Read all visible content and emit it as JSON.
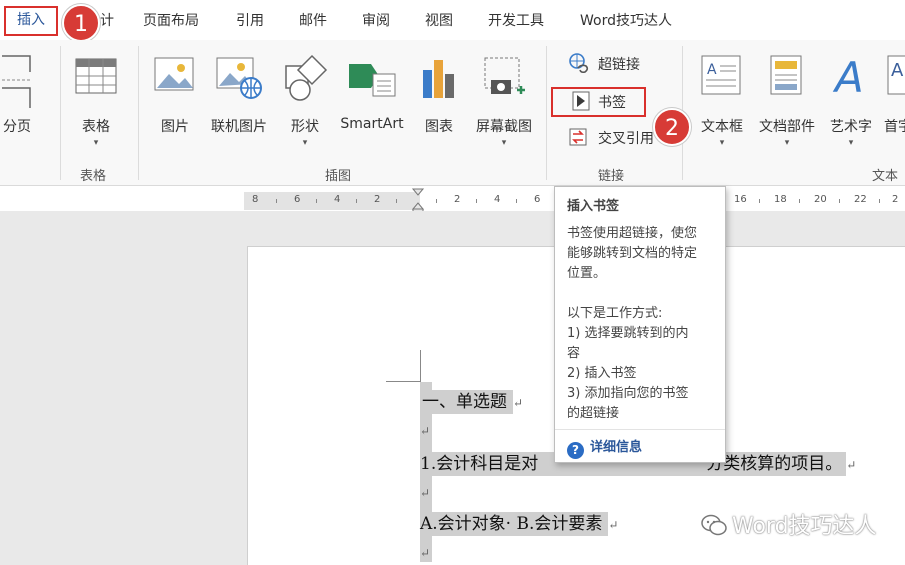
{
  "tabs": {
    "insert": "插入",
    "design_partial": "计",
    "page_layout": "页面布局",
    "references": "引用",
    "mailings": "邮件",
    "review": "审阅",
    "view": "视图",
    "developer": "开发工具",
    "addin": "Word技巧达人"
  },
  "badges": {
    "one": "1",
    "two": "2"
  },
  "ribbon": {
    "page_break": "分页",
    "table": "表格",
    "picture": "图片",
    "online_picture": "联机图片",
    "shapes": "形状",
    "smartart": "SmartArt",
    "chart": "图表",
    "screenshot": "屏幕截图",
    "hyperlink": "超链接",
    "bookmark": "书签",
    "cross_reference": "交叉引用",
    "textbox": "文本框",
    "quick_parts": "文档部件",
    "wordart": "艺术字",
    "dropcap_partial": "首字",
    "caret": "▾",
    "groups": {
      "tables": "表格",
      "illustrations": "插图",
      "links": "链接",
      "text": "文本"
    }
  },
  "ruler": {
    "labels": [
      "8",
      "6",
      "4",
      "2",
      "2",
      "4",
      "6",
      "16",
      "18",
      "20",
      "22",
      "2"
    ]
  },
  "tooltip": {
    "title": "插入书签",
    "desc_lines": [
      "书签使用超链接，使您",
      "能够跳转到文档的特定",
      "位置。"
    ],
    "how_lines": [
      "以下是工作方式:",
      "1) 选择要跳转到的内",
      "容",
      "2) 插入书签",
      "3) 添加指向您的书签",
      "的超链接"
    ],
    "help_icon": "?",
    "more_info": "详细信息"
  },
  "document": {
    "line1": "一、单选题",
    "line2a": "1.会计科目是对",
    "line2b": "分类核算的项目。",
    "line3": "A.会计对象· B.会计要素",
    "para_mark": "↵"
  },
  "watermark": "Word技巧达人",
  "colors": {
    "accent": "#2b579a",
    "highlight_red": "#d9302c",
    "badge_red": "#d73b36"
  }
}
